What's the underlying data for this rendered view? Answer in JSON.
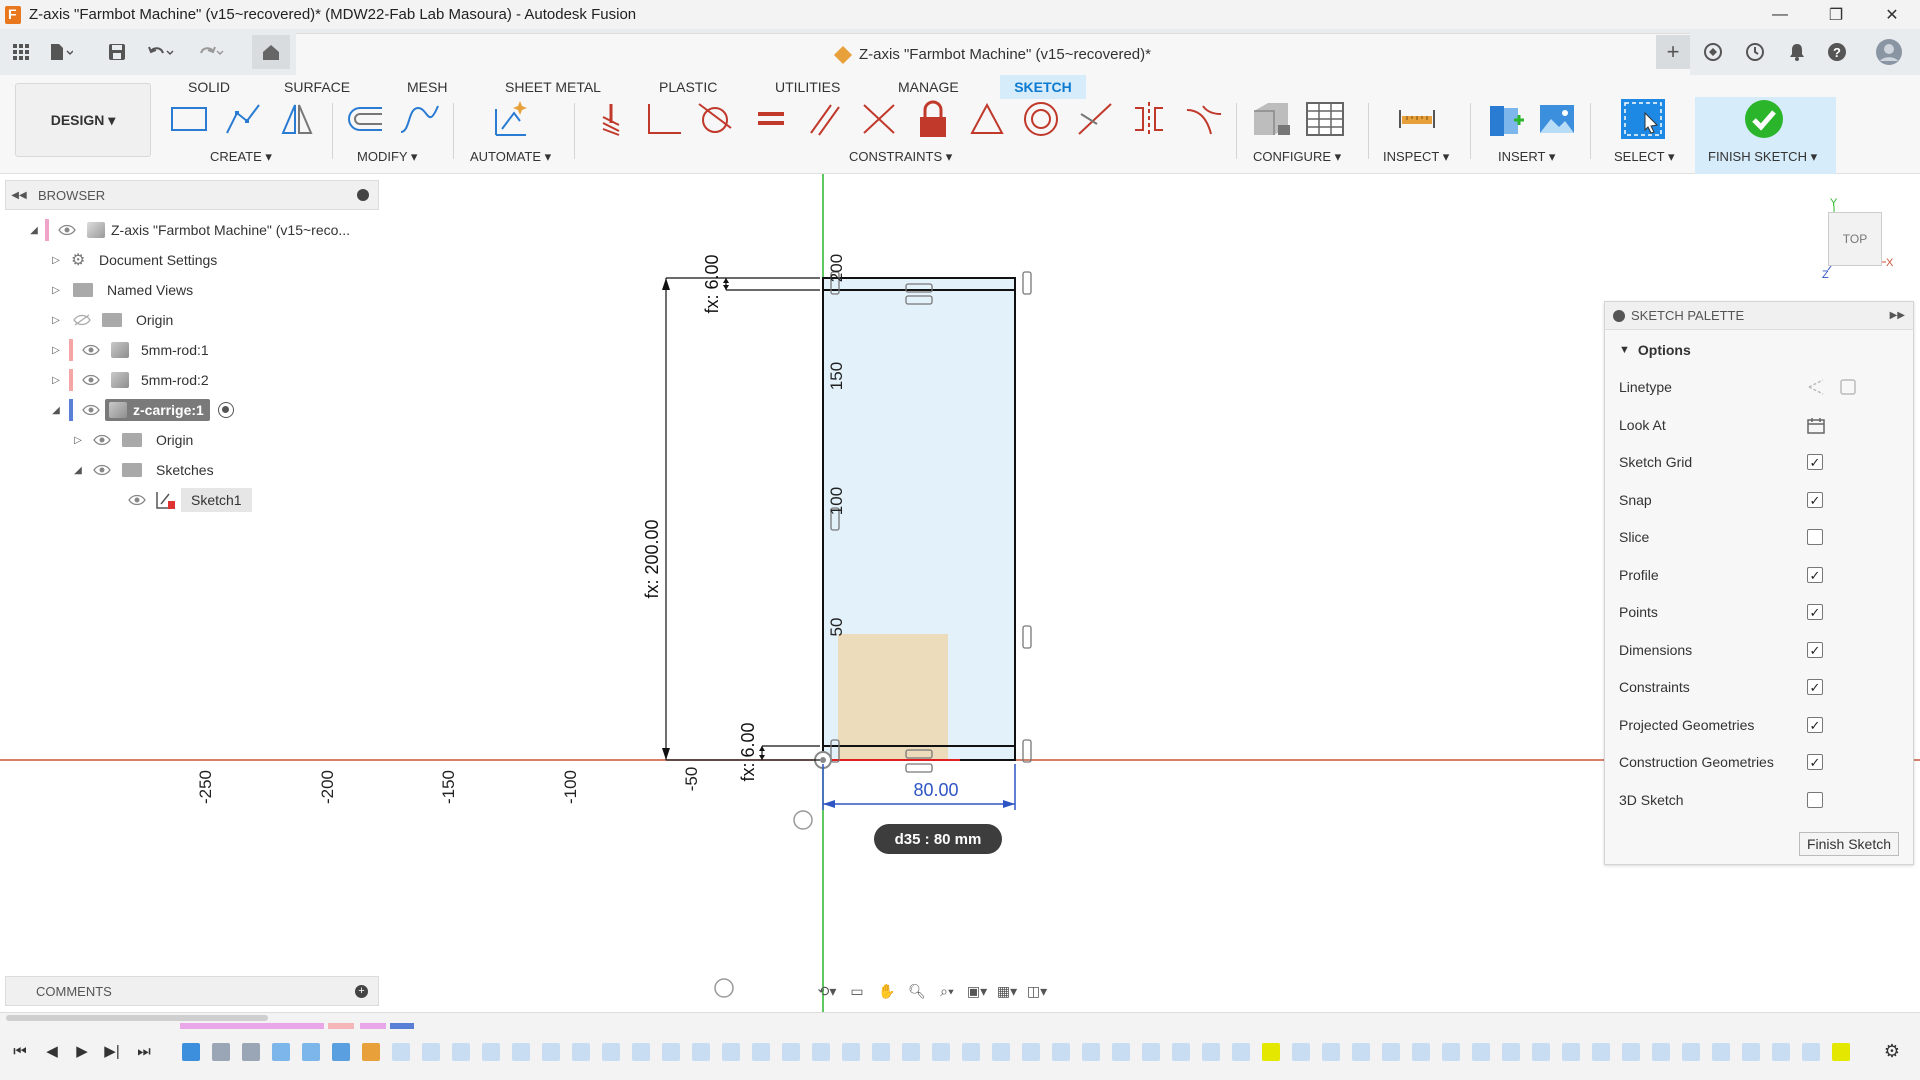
{
  "window": {
    "title": "Z-axis \"Farmbot Machine\" (v15~recovered)* (MDW22-Fab Lab Masoura) - Autodesk Fusion",
    "minimize": "—",
    "maximize": "❐",
    "close": "✕"
  },
  "document_tab": {
    "title": "Z-axis \"Farmbot Machine\" (v15~recovered)*",
    "close": "✕"
  },
  "toolbar": {
    "workspace_label": "DESIGN ▾",
    "tabs": [
      "SOLID",
      "SURFACE",
      "MESH",
      "SHEET METAL",
      "PLASTIC",
      "UTILITIES",
      "MANAGE",
      "SKETCH"
    ],
    "active_tab": "SKETCH",
    "groups": {
      "create": "CREATE ▾",
      "modify": "MODIFY ▾",
      "automate": "AUTOMATE ▾",
      "constraints": "CONSTRAINTS ▾",
      "configure": "CONFIGURE ▾",
      "inspect": "INSPECT ▾",
      "insert": "INSERT ▾",
      "select": "SELECT ▾",
      "finish_sketch": "FINISH SKETCH ▾"
    }
  },
  "browser": {
    "title": "BROWSER",
    "items": [
      {
        "label": "Z-axis \"Farmbot Machine\" (v15~reco...",
        "expanded": true
      },
      {
        "label": "Document Settings"
      },
      {
        "label": "Named Views"
      },
      {
        "label": "Origin"
      },
      {
        "label": "5mm-rod:1"
      },
      {
        "label": "5mm-rod:2"
      },
      {
        "label": "z-carrige:1",
        "active": true
      },
      {
        "label": "Origin"
      },
      {
        "label": "Sketches"
      },
      {
        "label": "Sketch1"
      }
    ]
  },
  "sketch": {
    "dimension_left_height": "fx: 200.00",
    "dimension_top": "fx: 6.00",
    "dimension_bottom": "fx: 6.00",
    "dimension_width": "80.00",
    "ruler_y": [
      "200",
      "150",
      "100",
      "50"
    ],
    "ruler_x": [
      "-250",
      "-200",
      "-150",
      "-100",
      "-50"
    ],
    "tooltip": "d35 : 80 mm"
  },
  "viewcube": {
    "label": "TOP",
    "axis_x": "X",
    "axis_y": "Y",
    "axis_z": "Z"
  },
  "palette": {
    "title": "SKETCH PALETTE",
    "section": "Options",
    "rows": [
      {
        "label": "Linetype",
        "type": "icons"
      },
      {
        "label": "Look At",
        "type": "icon"
      },
      {
        "label": "Sketch Grid",
        "checked": true
      },
      {
        "label": "Snap",
        "checked": true
      },
      {
        "label": "Slice",
        "checked": false
      },
      {
        "label": "Profile",
        "checked": true
      },
      {
        "label": "Points",
        "checked": true
      },
      {
        "label": "Dimensions",
        "checked": true
      },
      {
        "label": "Constraints",
        "checked": true
      },
      {
        "label": "Projected Geometries",
        "checked": true
      },
      {
        "label": "Construction Geometries",
        "checked": true
      },
      {
        "label": "3D Sketch",
        "checked": false
      }
    ],
    "finish_button": "Finish Sketch"
  },
  "comments": {
    "title": "COMMENTS"
  },
  "colors": {
    "accent": "#0b7ad0",
    "sketch_fill": "#e3f1fb",
    "profile_fill": "#ecd9b4",
    "x_axis": "#c8553a",
    "y_axis": "#2bb52b"
  }
}
